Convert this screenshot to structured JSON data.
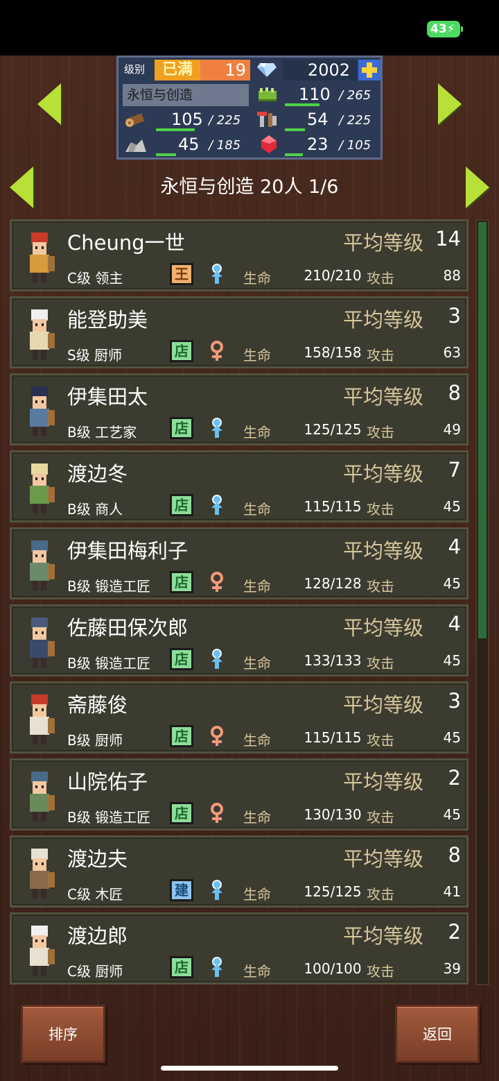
{
  "status": {
    "battery": "43"
  },
  "panel": {
    "level_label": "级别",
    "full_badge": "已满",
    "level": "19",
    "gems": "2002",
    "town_name": "永恒与创造",
    "resources": [
      {
        "name": "food-icon",
        "value": "110",
        "max": "/ 265",
        "fill": 0.42
      },
      {
        "name": "wood-icon",
        "value": "105",
        "max": "/ 225",
        "fill": 0.47
      },
      {
        "name": "tools-icon",
        "value": "54",
        "max": "/ 225",
        "fill": 0.24
      },
      {
        "name": "stone-icon",
        "value": "45",
        "max": "/ 185",
        "fill": 0.24
      },
      {
        "name": "ruby-icon",
        "value": "23",
        "max": "/ 105",
        "fill": 0.22
      }
    ]
  },
  "header": {
    "title": "永恒与创造  20人 1/6"
  },
  "list": {
    "avg_label": "平均等级",
    "hp_label": "生命",
    "atk_label": "攻击",
    "rows": [
      {
        "name": "Cheung一世",
        "level": "14",
        "grade": "C级 领主",
        "badge": "王",
        "badge_type": "king",
        "gender": "male",
        "hp": "210/210",
        "atk": "88",
        "hair": "#c83a2a",
        "cloth": "#d89a3a"
      },
      {
        "name": "能登助美",
        "level": "3",
        "grade": "S级 厨师",
        "badge": "店",
        "badge_type": "store",
        "gender": "female",
        "hp": "158/158",
        "atk": "63",
        "hair": "#f0f0f0",
        "cloth": "#e8d8b0"
      },
      {
        "name": "伊集田太",
        "level": "8",
        "grade": "B级 工艺家",
        "badge": "店",
        "badge_type": "store",
        "gender": "male",
        "hp": "125/125",
        "atk": "49",
        "hair": "#2a3050",
        "cloth": "#5a7aa0"
      },
      {
        "name": "渡边冬",
        "level": "7",
        "grade": "B级 商人",
        "badge": "店",
        "badge_type": "store",
        "gender": "male",
        "hp": "115/115",
        "atk": "45",
        "hair": "#e8d8a0",
        "cloth": "#6a9a4a"
      },
      {
        "name": "伊集田梅利子",
        "level": "4",
        "grade": "B级 锻造工匠",
        "badge": "店",
        "badge_type": "store",
        "gender": "female",
        "hp": "128/128",
        "atk": "45",
        "hair": "#4a6a8a",
        "cloth": "#6a8a6a"
      },
      {
        "name": "佐藤田保次郎",
        "level": "4",
        "grade": "B级 锻造工匠",
        "badge": "店",
        "badge_type": "store",
        "gender": "male",
        "hp": "133/133",
        "atk": "45",
        "hair": "#4a5a7a",
        "cloth": "#3a4a6a"
      },
      {
        "name": "斋藤俊",
        "level": "3",
        "grade": "B级 厨师",
        "badge": "店",
        "badge_type": "store",
        "gender": "female",
        "hp": "115/115",
        "atk": "45",
        "hair": "#c83a2a",
        "cloth": "#e8e0d0"
      },
      {
        "name": "山院佑子",
        "level": "2",
        "grade": "B级 锻造工匠",
        "badge": "店",
        "badge_type": "store",
        "gender": "female",
        "hp": "130/130",
        "atk": "45",
        "hair": "#4a6a8a",
        "cloth": "#6a8a5a"
      },
      {
        "name": "渡边夫",
        "level": "8",
        "grade": "C级 木匠",
        "badge": "建",
        "badge_type": "build",
        "gender": "male",
        "hp": "125/125",
        "atk": "41",
        "hair": "#e8e0d0",
        "cloth": "#8a6a4a"
      },
      {
        "name": "渡边郎",
        "level": "2",
        "grade": "C级 厨师",
        "badge": "店",
        "badge_type": "store",
        "gender": "male",
        "hp": "100/100",
        "atk": "39",
        "hair": "#f0f0f0",
        "cloth": "#e8e0d0"
      }
    ]
  },
  "footer": {
    "sort_label": "排序",
    "back_label": "返回"
  }
}
